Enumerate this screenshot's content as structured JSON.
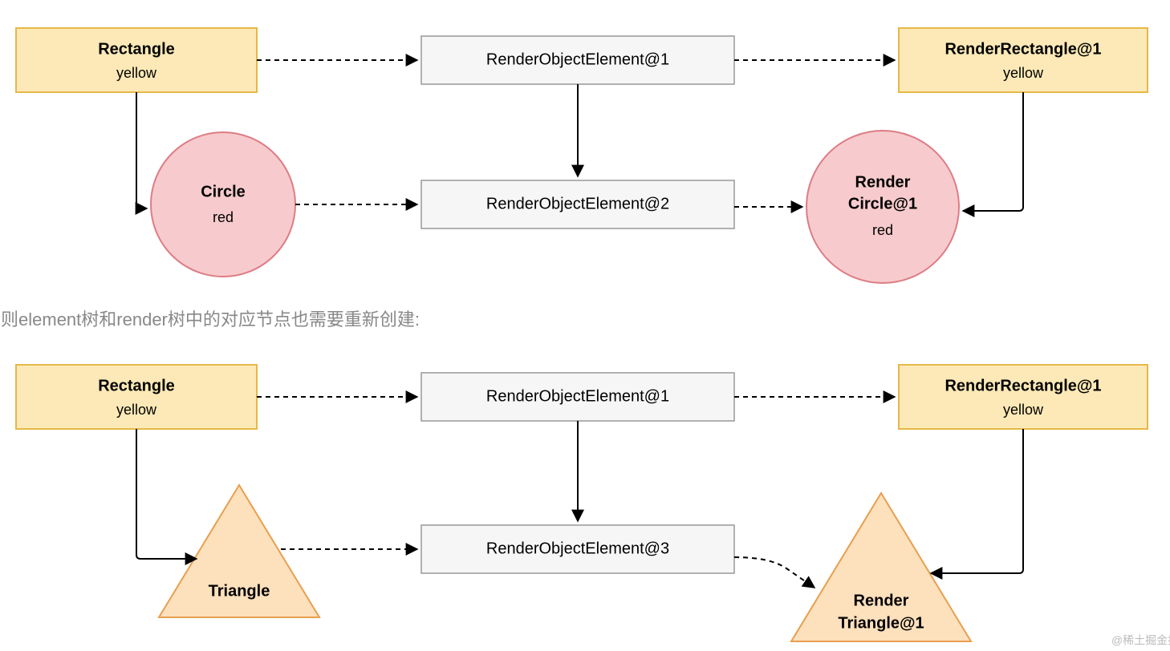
{
  "diagram1": {
    "rect": {
      "title": "Rectangle",
      "subtitle": "yellow"
    },
    "circle": {
      "title": "Circle",
      "subtitle": "red"
    },
    "el1": {
      "label": "RenderObjectElement@1"
    },
    "el2": {
      "label": "RenderObjectElement@2"
    },
    "rrect": {
      "title": "RenderRectangle@1",
      "subtitle": "yellow"
    },
    "rcircle": {
      "title1": "Render",
      "title2": "Circle@1",
      "subtitle": "red"
    }
  },
  "paragraph": "但是，如果控件树种某个节点的类型发生了变化，则element树和render树中的对应节点也需要重新创建:",
  "diagram2": {
    "rect": {
      "title": "Rectangle",
      "subtitle": "yellow"
    },
    "tri": {
      "title": "Triangle"
    },
    "el1": {
      "label": "RenderObjectElement@1"
    },
    "el3": {
      "label": "RenderObjectElement@3"
    },
    "rrect": {
      "title": "RenderRectangle@1",
      "subtitle": "yellow"
    },
    "rtri": {
      "title1": "Render",
      "title2": "Triangle@1"
    }
  },
  "watermark": "@稀土掘金技术社区",
  "colors": {
    "yellowFill": "#FCE9B7",
    "yellowStroke": "#E6B847",
    "redFill": "#F7CBCD",
    "redStroke": "#DE7C84",
    "grayFill": "#F6F6F6",
    "grayStroke": "#999999",
    "orangeFill": "#FDE0BC",
    "orangeStroke": "#E89F4E",
    "arrow": "#000000"
  }
}
